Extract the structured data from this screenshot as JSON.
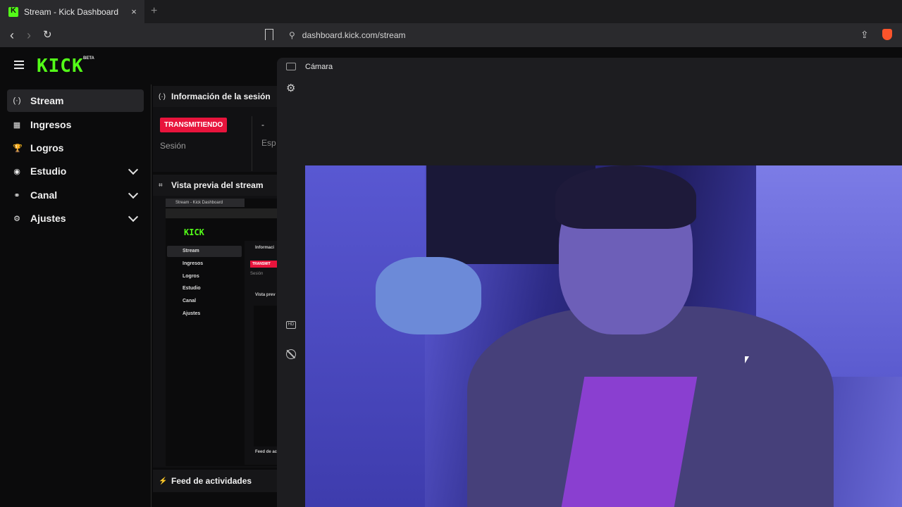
{
  "browser": {
    "tab_title": "Stream - Kick Dashboard",
    "tab_close": "×",
    "new_tab": "+",
    "url": "dashboard.kick.com/stream",
    "back": "‹",
    "forward": "›",
    "reload": "↻",
    "share": "⇪"
  },
  "sidebar": {
    "logo": "KICK",
    "logo_badge": "BETA",
    "items": [
      {
        "label": "Stream",
        "icon": "broadcast-icon",
        "glyph": "(·)",
        "active": true
      },
      {
        "label": "Ingresos",
        "icon": "chart-icon",
        "glyph": "▦"
      },
      {
        "label": "Logros",
        "icon": "trophy-icon",
        "glyph": "🏆"
      },
      {
        "label": "Estudio",
        "icon": "studio-icon",
        "glyph": "◉",
        "expandable": true
      },
      {
        "label": "Canal",
        "icon": "channel-icon",
        "glyph": "⚭",
        "expandable": true
      },
      {
        "label": "Ajustes",
        "icon": "gear-icon",
        "glyph": "⚙",
        "expandable": true
      }
    ]
  },
  "session": {
    "title": "Información de la sesión",
    "icon": "broadcast-icon",
    "status_badge": "TRANSMITIENDO",
    "session_label": "Sesión",
    "dash": "-",
    "truncated_label": "Esp"
  },
  "preview": {
    "title": "Vista previa del stream",
    "icon": "preview-icon",
    "mini": {
      "tab_title": "Stream - Kick Dashboard",
      "logo": "KICK",
      "items": [
        "Stream",
        "Ingresos",
        "Logros",
        "Estudio",
        "Canal",
        "Ajustes"
      ],
      "info_label": "Informaci",
      "badge": "TRANSMIT",
      "session": "Sesión",
      "preview_label": "Vista prev",
      "feed_label": "Feed de ac"
    }
  },
  "feed": {
    "title": "Feed de actividades",
    "icon": "bolt-icon"
  },
  "camera": {
    "title": "Cámara",
    "icon": "camera-icon",
    "settings_icon": "gear-icon",
    "hd_icon": "hd-off-icon",
    "timer_icon": "timer-off-icon"
  },
  "colors": {
    "brand": "#53fc18",
    "live": "#e8143c"
  }
}
